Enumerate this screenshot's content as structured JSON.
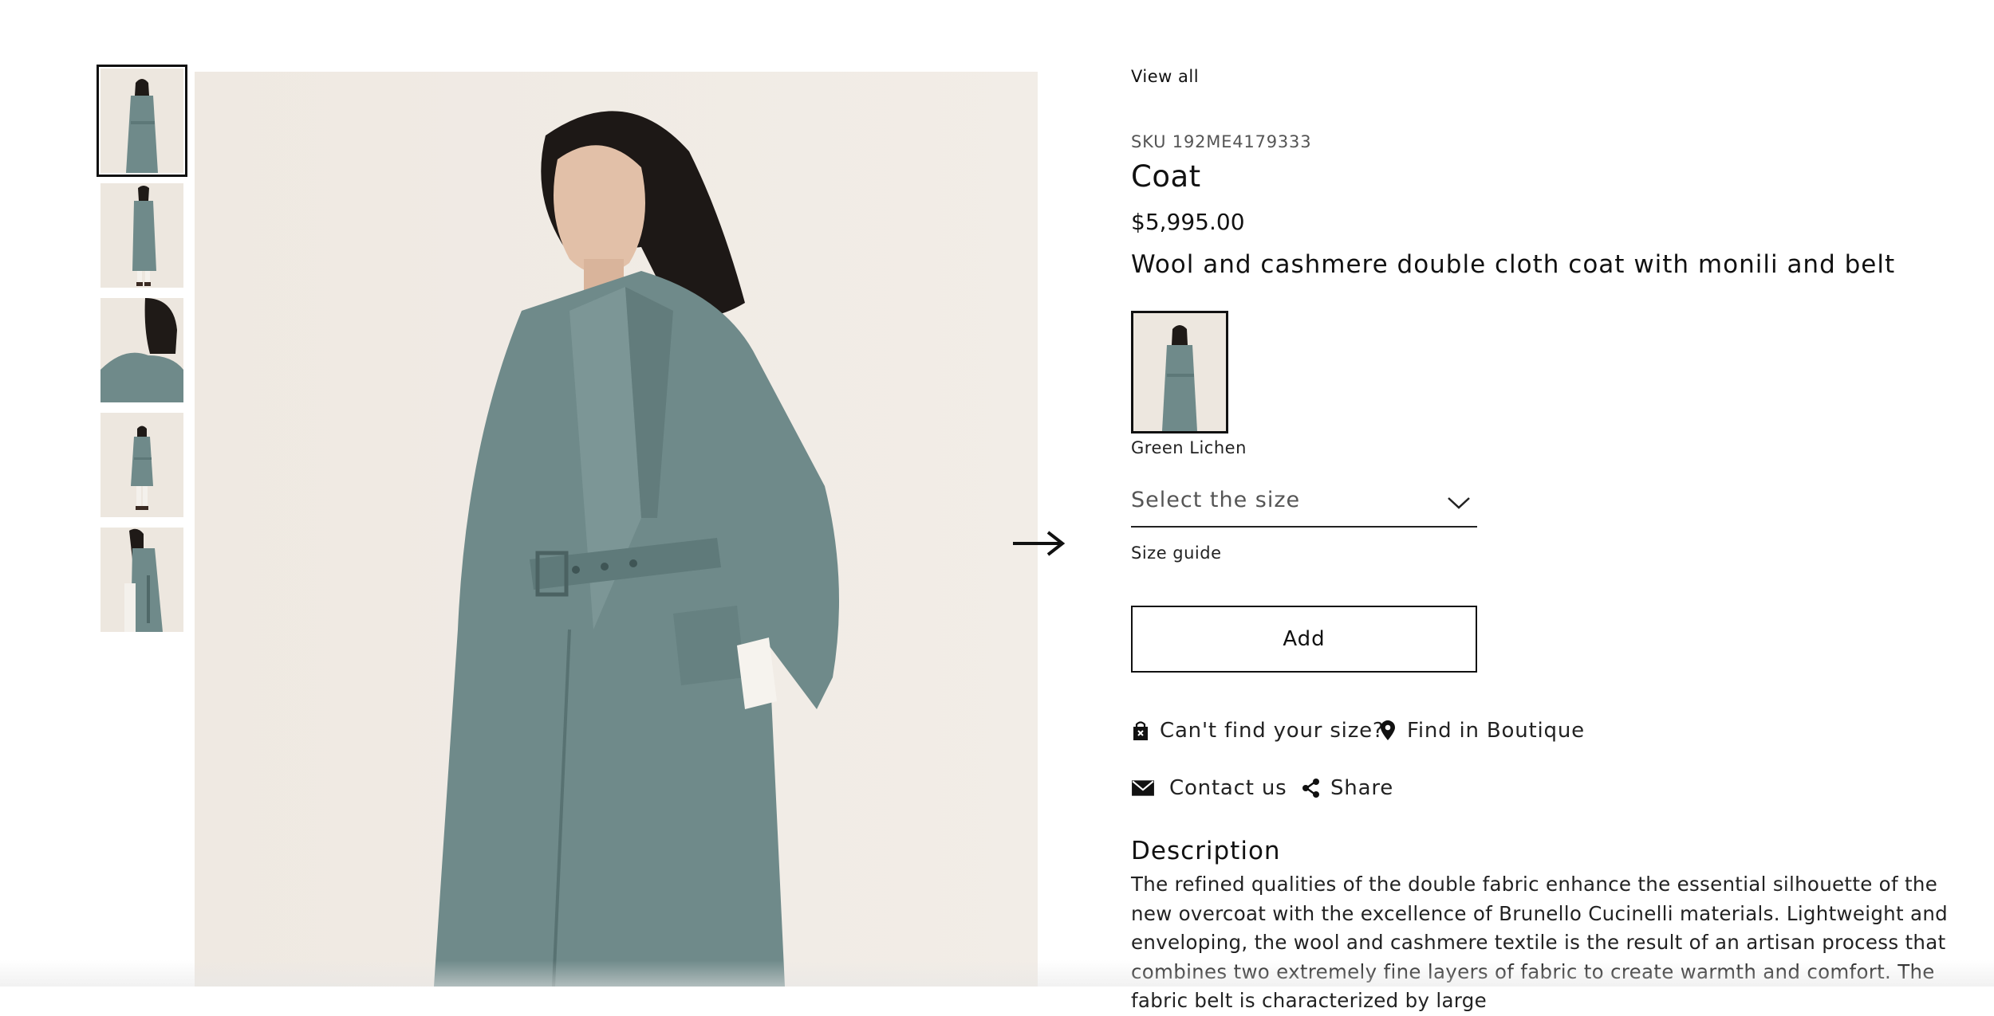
{
  "gallery": {
    "thumbnails": [
      {
        "name": "thumb-front-view",
        "active": true
      },
      {
        "name": "thumb-side-view",
        "active": false
      },
      {
        "name": "thumb-back-detail",
        "active": false
      },
      {
        "name": "thumb-full-length",
        "active": false
      },
      {
        "name": "thumb-profile-view",
        "active": false
      }
    ],
    "next_icon": "arrow-right-icon"
  },
  "product": {
    "view_all": "View all",
    "sku": "SKU 192ME4179333",
    "title": "Coat",
    "price": "$5,995.00",
    "subtitle": "Wool and cashmere double cloth coat with monili and belt",
    "color": {
      "name": "Green Lichen",
      "hex": "#6f8a8a"
    },
    "size_select_label": "Select the size",
    "size_guide": "Size guide",
    "add_label": "Add"
  },
  "actions": {
    "cant_find_size": "Can't find your size?",
    "find_in_boutique": "Find in Boutique",
    "contact_us": "Contact us",
    "share": "Share"
  },
  "description": {
    "title": "Description",
    "text": "The refined qualities of the double fabric enhance the essential silhouette of the new overcoat with the excellence of Brunello Cucinelli materials. Lightweight and enveloping, the wool and cashmere textile is the result of an artisan process that combines two extremely fine layers of fabric to create warmth and comfort. The fabric belt is characterized by large"
  },
  "colors": {
    "background": "#ffffff",
    "image_bg": "#f1ece5",
    "coat": "#6f8a8a",
    "text": "#111111"
  }
}
